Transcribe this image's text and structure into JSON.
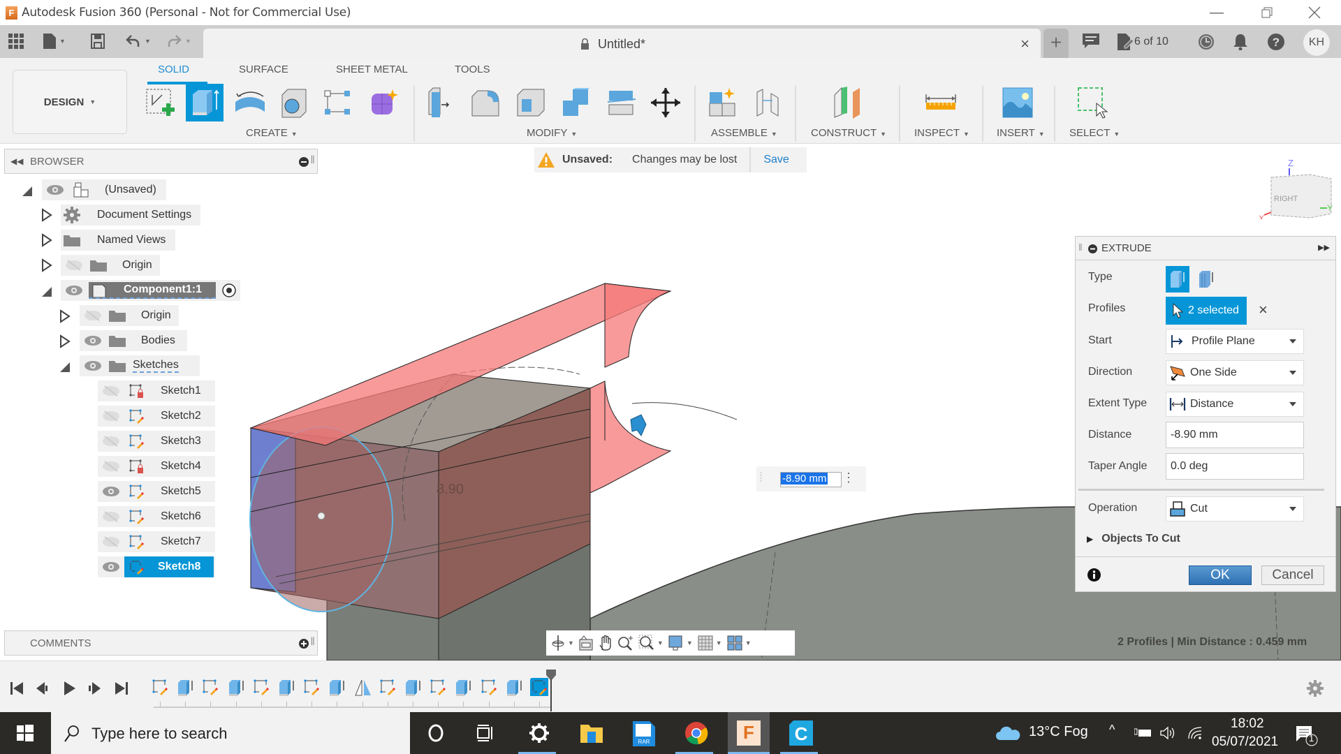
{
  "window": {
    "title": "Autodesk Fusion 360 (Personal - Not for Commercial Use)",
    "controls": [
      "minimize",
      "restore",
      "close"
    ]
  },
  "appbar": {
    "document_tab": "Untitled*",
    "job_status": "6 of 10",
    "user_initials": "KH"
  },
  "toolbar": {
    "workspace": "DESIGN",
    "tabs": [
      {
        "label": "SOLID",
        "active": true
      },
      {
        "label": "SURFACE",
        "active": false
      },
      {
        "label": "SHEET METAL",
        "active": false
      },
      {
        "label": "TOOLS",
        "active": false
      }
    ],
    "groups": {
      "create": "CREATE",
      "modify": "MODIFY",
      "assemble": "ASSEMBLE",
      "construct": "CONSTRUCT",
      "inspect": "INSPECT",
      "insert": "INSERT",
      "select": "SELECT"
    }
  },
  "banner": {
    "title": "Unsaved:",
    "message": "Changes may be lost",
    "action": "Save"
  },
  "browser": {
    "title": "BROWSER",
    "items": [
      {
        "label": "(Unsaved)",
        "level": 0,
        "expanded": true,
        "visible": true
      },
      {
        "label": "Document Settings",
        "level": 1,
        "expanded": false
      },
      {
        "label": "Named Views",
        "level": 1,
        "expanded": false
      },
      {
        "label": "Origin",
        "level": 1,
        "expanded": false,
        "visible": false
      },
      {
        "label": "Component1:1",
        "level": 1,
        "expanded": true,
        "visible": true,
        "active": true
      },
      {
        "label": "Origin",
        "level": 2,
        "expanded": false,
        "visible": false
      },
      {
        "label": "Bodies",
        "level": 2,
        "expanded": false,
        "visible": true
      },
      {
        "label": "Sketches",
        "level": 2,
        "expanded": true,
        "visible": true
      }
    ],
    "sketches": [
      {
        "label": "Sketch1",
        "visible": false,
        "locked": true
      },
      {
        "label": "Sketch2",
        "visible": false,
        "locked": false
      },
      {
        "label": "Sketch3",
        "visible": false,
        "locked": false
      },
      {
        "label": "Sketch4",
        "visible": false,
        "locked": true
      },
      {
        "label": "Sketch5",
        "visible": true,
        "locked": false
      },
      {
        "label": "Sketch6",
        "visible": false,
        "locked": false
      },
      {
        "label": "Sketch7",
        "visible": false,
        "locked": false
      },
      {
        "label": "Sketch8",
        "visible": true,
        "locked": false,
        "selected": true
      }
    ]
  },
  "comments": {
    "title": "COMMENTS"
  },
  "viewcube": {
    "face": "RIGHT",
    "axes": [
      "X",
      "Y",
      "Z"
    ]
  },
  "viewport": {
    "dimension_label": "8.90",
    "dimension_input": "-8.90 mm",
    "status": "2 Profiles | Min Distance : 0.459 mm"
  },
  "extrude": {
    "title": "EXTRUDE",
    "fields": {
      "type_label": "Type",
      "profiles_label": "Profiles",
      "profiles_value": "2 selected",
      "start_label": "Start",
      "start_value": "Profile Plane",
      "direction_label": "Direction",
      "direction_value": "One Side",
      "extent_label": "Extent Type",
      "extent_value": "Distance",
      "distance_label": "Distance",
      "distance_value": "-8.90 mm",
      "taper_label": "Taper Angle",
      "taper_value": "0.0 deg",
      "operation_label": "Operation",
      "operation_value": "Cut",
      "objects_to_cut": "Objects To Cut"
    },
    "ok": "OK",
    "cancel": "Cancel"
  },
  "timeline": {
    "features": [
      "sketch",
      "extrude",
      "sketch",
      "extrude",
      "sketch",
      "extrude",
      "sketch",
      "extrude",
      "mirror",
      "sketch",
      "extrude",
      "sketch",
      "extrude",
      "sketch",
      "extrude",
      "sketch"
    ],
    "active_index": 15
  },
  "taskbar": {
    "search_placeholder": "Type here to search",
    "weather": "13°C  Fog",
    "time": "18:02",
    "date": "05/07/2021",
    "notifications": "1",
    "apps": [
      "cortana",
      "task-view",
      "settings",
      "file-explorer",
      "winrar",
      "chrome",
      "fusion-360",
      "ccleaner"
    ]
  },
  "colors": {
    "accent": "#0696d7",
    "cut_preview": "#f08080",
    "selected_face": "#6f7fd0",
    "body_gray": "#8a8e88"
  }
}
